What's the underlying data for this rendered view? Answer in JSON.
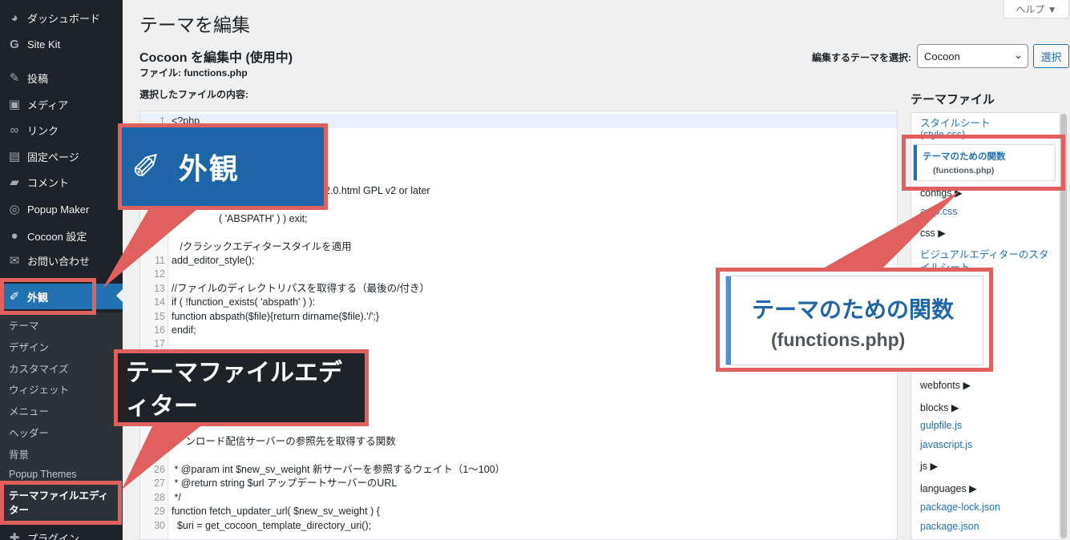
{
  "sidebar": {
    "items": [
      {
        "label": "ダッシュボード",
        "icon": "dashboard-icon",
        "glyph": "◕"
      },
      {
        "label": "Site Kit",
        "icon": "google-g-icon",
        "glyph": "G"
      },
      {
        "label": "投稿",
        "icon": "pin-icon",
        "glyph": "✎"
      },
      {
        "label": "メディア",
        "icon": "media-icon",
        "glyph": "▣"
      },
      {
        "label": "リンク",
        "icon": "link-icon",
        "glyph": "∞"
      },
      {
        "label": "固定ページ",
        "icon": "page-icon",
        "glyph": "▤"
      },
      {
        "label": "コメント",
        "icon": "comment-icon",
        "glyph": "▰"
      },
      {
        "label": "Popup Maker",
        "icon": "popup-icon",
        "glyph": "◎"
      },
      {
        "label": "Cocoon 設定",
        "icon": "cocoon-icon",
        "glyph": "●"
      },
      {
        "label": "お問い合わせ",
        "icon": "mail-icon",
        "glyph": "✉"
      },
      {
        "label": "外観",
        "icon": "brush-icon",
        "glyph": "✐"
      }
    ],
    "submenu": [
      "テーマ",
      "デザイン",
      "カスタマイズ",
      "ウィジェット",
      "メニュー",
      "ヘッダー",
      "背景",
      "Popup Themes",
      "テーマファイルエディター"
    ],
    "next_item": "プラグイン"
  },
  "header": {
    "help_label": "ヘルプ ▼",
    "page_title": "テーマを編集",
    "editing_heading": "Cocoon を編集中 (使用中)",
    "file_line": "ファイル: functions.php",
    "content_label": "選択したファイルの内容:",
    "theme_select_label": "編集するテーマを選択:",
    "theme_select_value": "Cocoon",
    "select_button": "選択"
  },
  "editor": {
    "lines": [
      {
        "n": "1",
        "code": "<?php",
        "cls": "c-kw"
      },
      {
        "n": "",
        "code": "",
        "cls": ""
      },
      {
        "n": "",
        "code": "",
        "cls": ""
      },
      {
        "n": "",
        "code": "",
        "cls": ""
      },
      {
        "n": "",
        "code": "                                   /",
        "cls": "c-comment"
      },
      {
        "n": "",
        "code": "                                   licenses/gpl-2.0.html GPL v2 or later",
        "cls": "c-comment"
      },
      {
        "n": "",
        "code": "",
        "cls": ""
      },
      {
        "n": "",
        "code": "                 ( 'ABSPATH' ) ) exit;",
        "cls": "c-str"
      },
      {
        "n": "",
        "code": "",
        "cls": ""
      },
      {
        "n": "",
        "code": "   /クラシックエディタースタイルを適用",
        "cls": "c-comment"
      },
      {
        "n": "11",
        "code": "add_editor_style();",
        "cls": ""
      },
      {
        "n": "12",
        "code": "",
        "cls": ""
      },
      {
        "n": "13",
        "code": "//ファイルのディレクトリパスを取得する（最後の/付き）",
        "cls": "c-comment"
      },
      {
        "n": "14",
        "code": "if ( !function_exists( 'abspath' ) ):",
        "cls": ""
      },
      {
        "n": "15",
        "code": "function abspath($file){return dirname($file).'/';}",
        "cls": "c-var"
      },
      {
        "n": "16",
        "code": "endif;",
        "cls": "c-kw"
      },
      {
        "n": "17",
        "code": "",
        "cls": ""
      },
      {
        "n": "",
        "code": "",
        "cls": ""
      },
      {
        "n": "",
        "code": "                                  ns.php';",
        "cls": "c-str"
      },
      {
        "n": "",
        "code": "",
        "cls": ""
      },
      {
        "n": "",
        "code": "                                  orts.php';",
        "cls": "c-str"
      },
      {
        "n": "",
        "code": "",
        "cls": ""
      },
      {
        "n": "23",
        "code": "",
        "cls": ""
      },
      {
        "n": "2",
        "code": "     ンロード配信サーバーの参照先を取得する関数",
        "cls": "c-comment"
      },
      {
        "n": "",
        "code": "",
        "cls": ""
      },
      {
        "n": "26",
        "code": " * @param int $new_sv_weight 新サーバーを参照するウェイト（1〜100）",
        "cls": "c-comment"
      },
      {
        "n": "27",
        "code": " * @return string $url アップデートサーバーのURL",
        "cls": "c-comment"
      },
      {
        "n": "28",
        "code": " */",
        "cls": "c-comment"
      },
      {
        "n": "29",
        "code": "function fetch_updater_url( $new_sv_weight ) {",
        "cls": "c-var"
      },
      {
        "n": "30",
        "code": "  $uri = get_cocoon_template_directory_uri();",
        "cls": ""
      }
    ]
  },
  "files": {
    "title": "テーマファイル",
    "items": [
      {
        "label": "スタイルシート",
        "kind": "link"
      },
      {
        "label": "(style.css)",
        "kind": "link"
      },
      {
        "label": "configs ▶",
        "kind": "folder"
      },
      {
        "label": "amp.css",
        "kind": "link"
      },
      {
        "label": "css ▶",
        "kind": "folder"
      },
      {
        "label": "ビジュアルエディターのスタ",
        "kind": "link"
      },
      {
        "label": "イルシート",
        "kind": "link"
      },
      {
        "label": "webfonts ▶",
        "kind": "folder"
      },
      {
        "label": "blocks ▶",
        "kind": "folder"
      },
      {
        "label": "gulpfile.js",
        "kind": "link"
      },
      {
        "label": "javascript.js",
        "kind": "link"
      },
      {
        "label": "js ▶",
        "kind": "folder"
      },
      {
        "label": "languages ▶",
        "kind": "folder"
      },
      {
        "label": "package-lock.json",
        "kind": "link"
      },
      {
        "label": "package.json",
        "kind": "link"
      }
    ],
    "current_title": "テーマのための関数",
    "current_file": "(functions.php)"
  },
  "callouts": {
    "appearance": "外観",
    "editor": "テーマファイルエディター",
    "functions_title": "テーマのための関数",
    "functions_file": "(functions.php)"
  },
  "colors": {
    "accent": "#2271b1",
    "callout_border": "#e06060",
    "sidebar_bg": "#1d2327"
  }
}
